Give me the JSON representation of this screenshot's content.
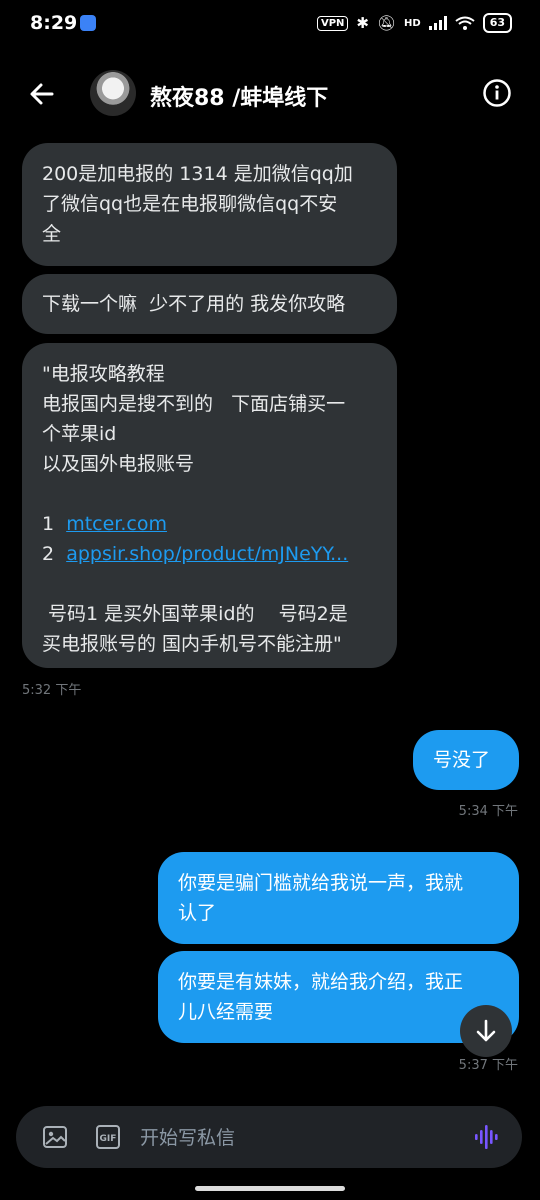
{
  "status_bar": {
    "time": "8:29",
    "vpn": "VPN",
    "network": "HD",
    "battery": "63"
  },
  "header": {
    "title": "熬夜88 /蚌埠线下"
  },
  "messages": [
    {
      "lines": [
        "200是加电报的 1314 是加微信qq加",
        "了微信qq也是在电报聊微信qq不安",
        "全"
      ]
    },
    {
      "lines": [
        "下载一个嘛  少不了用的 我发你攻略"
      ]
    },
    {
      "lines": [
        "\"电报攻略教程",
        "电报国内是搜不到的   下面店铺买一",
        "个苹果id",
        "以及国外电报账号"
      ],
      "link1_num": "1",
      "link1": "mtcer.com",
      "link2_num": "2",
      "link2": "appsir.shop/product/mJNeYY...",
      "tail": [
        " 号码1 是买外国苹果id的    号码2是",
        "买电报账号的 国内手机号不能注册\""
      ]
    },
    {
      "time": "5:32 下午"
    },
    {
      "lines": [
        "号没了"
      ],
      "time": "5:34 下午"
    },
    {
      "lines": [
        "你要是骗门槛就给我说一声，我就",
        "认了"
      ]
    },
    {
      "lines": [
        "你要是有妹妹，就给我介绍，我正",
        "儿八经需要"
      ],
      "time": "5:37 下午"
    }
  ],
  "composer": {
    "placeholder": "开始写私信",
    "gif_label": "GIF"
  },
  "colors": {
    "sent_bubble": "#1d9bf0",
    "received_bubble": "#2f3336",
    "link": "#1d9bf0",
    "background": "#000000"
  }
}
